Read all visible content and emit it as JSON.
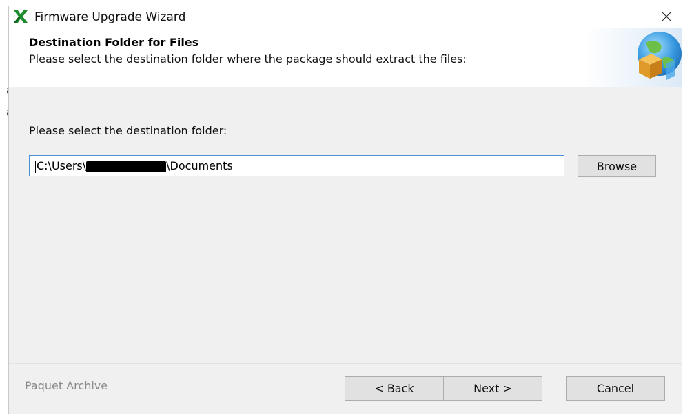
{
  "window": {
    "title": "Firmware Upgrade Wizard",
    "app_icon": "green-x-logo-icon",
    "close_icon": "close-icon"
  },
  "header": {
    "title": "Destination Folder for Files",
    "subtitle": "Please select the destination folder where the package should extract the files:",
    "art_icon": "globe-box-icon"
  },
  "main": {
    "prompt": "Please select the destination folder:",
    "path_prefix": "C:\\Users\\",
    "path_suffix": "\\Documents",
    "browse_label": "Browse"
  },
  "footer": {
    "brand": "Paquet Archive",
    "back_label": "< Back",
    "next_label": "Next >",
    "cancel_label": "Cancel"
  },
  "background": {
    "edge_letters": [
      "a",
      "a"
    ]
  },
  "colors": {
    "accent_border": "#4a90d9",
    "logo_green": "#1e8c2e"
  }
}
